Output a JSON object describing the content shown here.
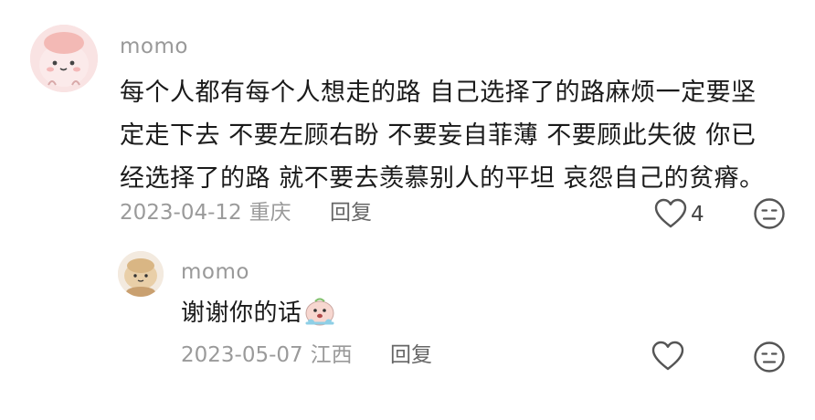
{
  "comment": {
    "username": "momo",
    "avatar_icon": "cartoon-avatar",
    "text_lines": [
      "每个人都有每个人想走的路 自己选择了的路麻烦一定要坚",
      "定走下去 不要左顾右盼 不要妄自菲薄 不要顾此失彼 你已",
      "经选择了的路 就不要去羡慕别人的平坦 哀怨自己的贫瘠。"
    ],
    "date": "2023-04-12",
    "location": "重庆",
    "reply_label": "回复",
    "like_count": "4",
    "like_icon": "heart-outline-icon",
    "dislike_icon": "neutral-face-icon"
  },
  "reply": {
    "username": "momo",
    "avatar_icon": "cartoon-avatar",
    "text": "谢谢你的话",
    "sticker_icon": "crying-sticker",
    "date": "2023-05-07",
    "location": "江西",
    "reply_label": "回复",
    "like_icon": "heart-outline-icon",
    "dislike_icon": "neutral-face-icon"
  },
  "colors": {
    "text_primary": "#1a1a1a",
    "text_secondary": "#999999",
    "icon_stroke": "#555555"
  }
}
